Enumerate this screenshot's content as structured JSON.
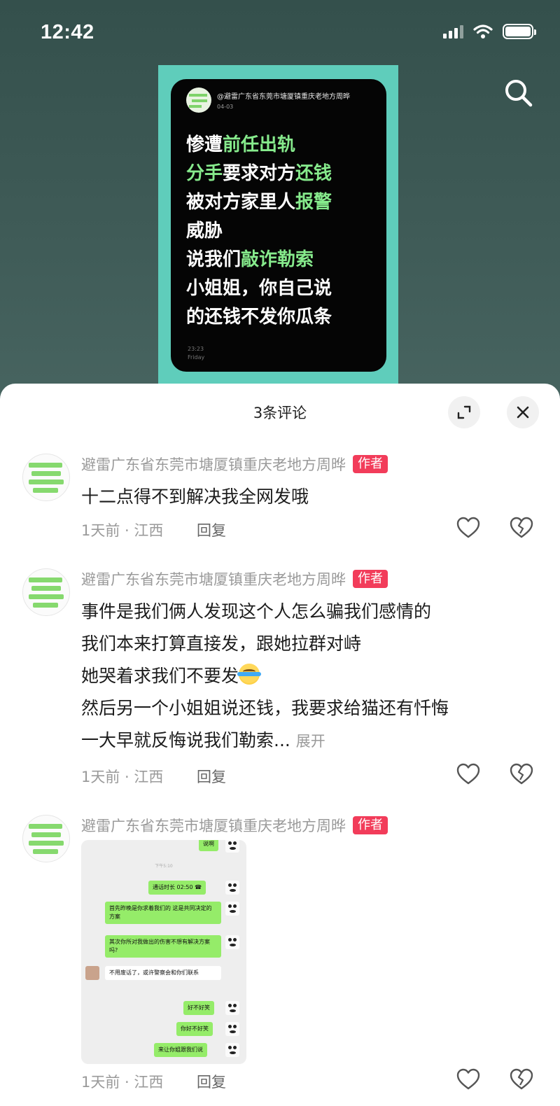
{
  "status": {
    "time": "12:42"
  },
  "icons": {
    "search": "search-icon",
    "expand": "expand-icon",
    "close": "close-icon",
    "like": "heart-icon",
    "dislike": "broken-heart-icon"
  },
  "video": {
    "author": "@避雷广东省东莞市塘厦镇重庆老地方周晔",
    "date": "04-03",
    "lines": [
      [
        {
          "t": "惨遭",
          "h": false
        },
        {
          "t": "前任出轨",
          "h": true
        }
      ],
      [
        {
          "t": "分手",
          "h": true
        },
        {
          "t": "要求对方",
          "h": false
        },
        {
          "t": "还钱",
          "h": true
        }
      ],
      [
        {
          "t": "被对方家里人",
          "h": false
        },
        {
          "t": "报警",
          "h": true
        }
      ],
      [
        {
          "t": "威胁",
          "h": false
        }
      ],
      [
        {
          "t": "说我们",
          "h": false
        },
        {
          "t": "敲诈勒索",
          "h": true
        }
      ],
      [
        {
          "t": "小姐姐，你自己说",
          "h": false
        }
      ],
      [
        {
          "t": "的还钱不发你瓜条",
          "h": false
        }
      ]
    ],
    "footer_time": "23:23",
    "footer_day": "Friday"
  },
  "comments": {
    "title": "3条评论",
    "items": [
      {
        "name": "避雷广东省东莞市塘厦镇重庆老地方周晔",
        "badge": "作者",
        "lines": [
          "十二点得不到解决我全网发哦"
        ],
        "meta": "1天前 · 江西",
        "reply": "回复"
      },
      {
        "name": "避雷广东省东莞市塘厦镇重庆老地方周晔",
        "badge": "作者",
        "lines": [
          "事件是我们俩人发现这个人怎么骗我们感情的",
          "我们本来打算直接发，跟她拉群对峙",
          "她哭着求我们不要发",
          "然后另一个小姐姐说还钱，我要求给猫还有忏悔",
          "一大早就反悔说我们勒索..."
        ],
        "expand": "展开",
        "meta": "1天前 · 江西",
        "reply": "回复"
      },
      {
        "name": "避雷广东省东莞市塘厦镇重庆老地方周晔",
        "badge": "作者",
        "meta": "1天前 · 江西",
        "reply": "回复"
      }
    ]
  },
  "chat_image": {
    "time": "下午5:10",
    "top_partial": "说啊",
    "call": "通话时长 02:50",
    "msg1": "首先昨晚是你求着我们的 这是共同决定的方案",
    "msg2": "其次你所对我做出的伤害不想有解决方案吗?",
    "msg3": "不用废话了，或许警察会和你们联系",
    "msg4": "好不好笑",
    "msg5": "你好不好笑",
    "msg6": "来让你姐跟我们说"
  }
}
